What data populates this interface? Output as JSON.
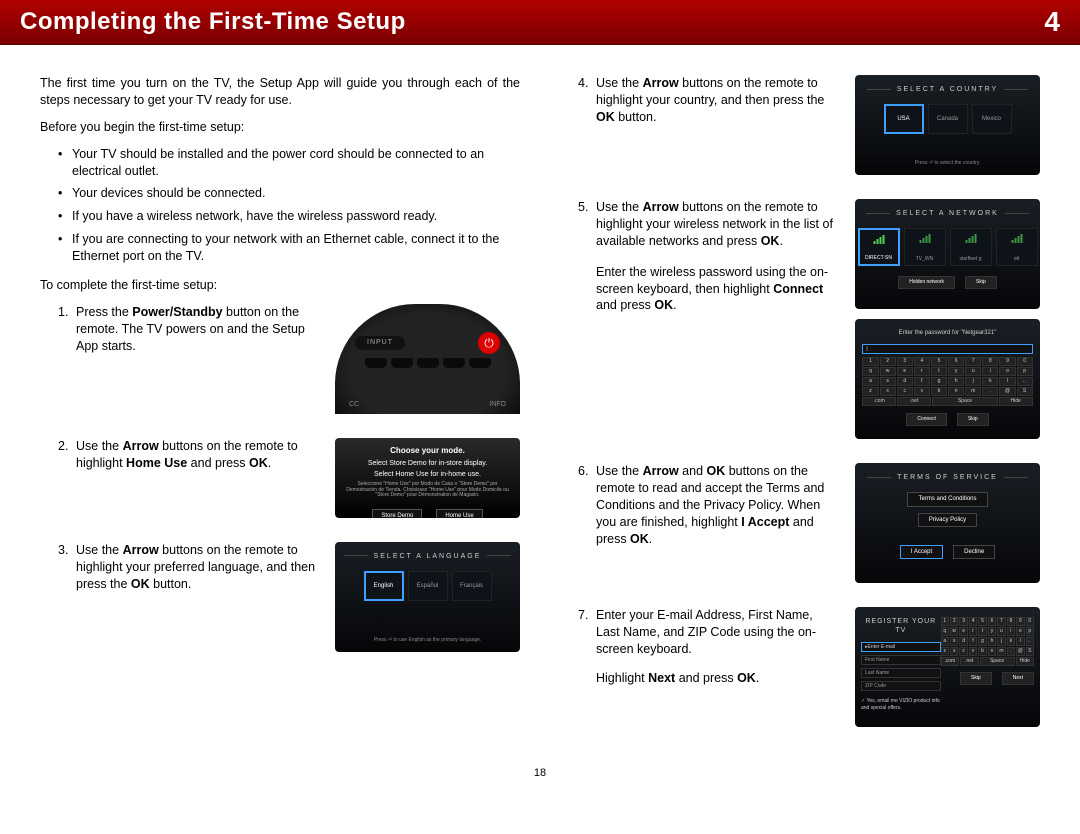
{
  "header": {
    "title": "Completing the First-Time Setup",
    "chapter": "4"
  },
  "page_number": "18",
  "intro": "The first time you turn on the TV, the Setup App will guide you through each of the steps necessary to get your TV ready for use.",
  "before_label": "Before you begin the first-time setup:",
  "before_items": [
    "Your TV should be installed and the power cord should be connected to an electrical outlet.",
    "Your devices should be connected.",
    "If you have a wireless network, have the wireless password ready.",
    "If you are connecting to your network with an Ethernet cable, connect it to the Ethernet port on the TV."
  ],
  "complete_label": "To complete the first-time setup:",
  "steps": {
    "s1": {
      "num": "1.",
      "pre": "Press the ",
      "bold": "Power/Standby",
      "post": " button on the remote. The TV powers on and the Setup App starts."
    },
    "s2": {
      "num": "2.",
      "p1": "Use the ",
      "b1": "Arrow",
      "p2": " buttons on the remote to highlight ",
      "b2": "Home Use",
      "p3": " and press ",
      "b3": "OK",
      "p4": "."
    },
    "s3": {
      "num": "3.",
      "p1": "Use the ",
      "b1": "Arrow",
      "p2": " buttons on the remote to highlight your preferred language, and then press the ",
      "b2": "OK",
      "p3": " button."
    },
    "s4": {
      "num": "4.",
      "p1": "Use the ",
      "b1": "Arrow",
      "p2": " buttons on the remote to highlight your country, and then press the ",
      "b2": "OK",
      "p3": " button."
    },
    "s5": {
      "num": "5.",
      "para1": {
        "p1": "Use the ",
        "b1": "Arrow",
        "p2": " buttons on the remote to highlight your wireless network in the list of available networks and press ",
        "b2": "OK",
        "p3": "."
      },
      "para2": {
        "p1": "Enter the wireless password using the on-screen keyboard, then highlight ",
        "b1": "Connect",
        "p2": " and press ",
        "b2": "OK",
        "p3": "."
      }
    },
    "s6": {
      "num": "6.",
      "p1": "Use the ",
      "b1": "Arrow",
      "p2": " and ",
      "b2": "OK",
      "p3": " buttons on the remote to read and accept the Terms and Conditions and the Privacy Policy. When you are finished, highlight ",
      "b3": "I Accept",
      "p4": " and press ",
      "b4": "OK",
      "p5": "."
    },
    "s7": {
      "num": "7.",
      "para1": "Enter your E-mail Address, First Name, Last Name, and ZIP Code using the on-screen keyboard.",
      "para2": {
        "p1": "Highlight ",
        "b1": "Next",
        "p2": " and press ",
        "b2": "OK",
        "p3": "."
      }
    }
  },
  "thumbs": {
    "remote": {
      "input": "INPUT",
      "cc": "CC",
      "info": "INFO"
    },
    "mode": {
      "t1": "Choose your mode.",
      "t2": "Select Store Demo for in-store display.",
      "t3": "Select Home Use for in-home use.",
      "sub": "Seleccione \"Home Use\" por Modo de Casa o \"Store Demo\" por Demostración de Tienda. Choisissez \"Home Use\" pour Mode Domicile ou \"Store Demo\" pour Démonstration de Magasin.",
      "b1": "Store Demo",
      "b2": "Home Use"
    },
    "lang": {
      "title": "SELECT A LANGUAGE",
      "o1": "English",
      "o2": "Español",
      "o3": "Français",
      "hint": "Press ⏎ to use English as the primary language."
    },
    "country": {
      "title": "SELECT A COUNTRY",
      "o1": "USA",
      "o2": "Canada",
      "o3": "Mexico",
      "hint": "Press ⏎ to select the country."
    },
    "network": {
      "title": "SELECT A NETWORK",
      "o1": "DIRECT-SN",
      "o2": "TV_WN",
      "o3": "starfleet g",
      "o4": "ott",
      "b1": "Hidden network",
      "b2": "Skip"
    },
    "password": {
      "label": "Enter the password for \"Netgear321\"",
      "b1": "Connect",
      "b2": "Skip"
    },
    "tos": {
      "title": "TERMS OF SERVICE",
      "l1": "Terms and Conditions",
      "l2": "Privacy Policy",
      "b1": "I Accept",
      "b2": "Decline"
    },
    "register": {
      "title": "REGISTER YOUR TV",
      "f1": "Enter E-mail",
      "f2": "First Name",
      "f3": "Last Name",
      "f4": "ZIP Code",
      "chk": "Yes, email me VIZIO product info and special offers.",
      "b1": "Skip",
      "b2": "Next"
    }
  }
}
